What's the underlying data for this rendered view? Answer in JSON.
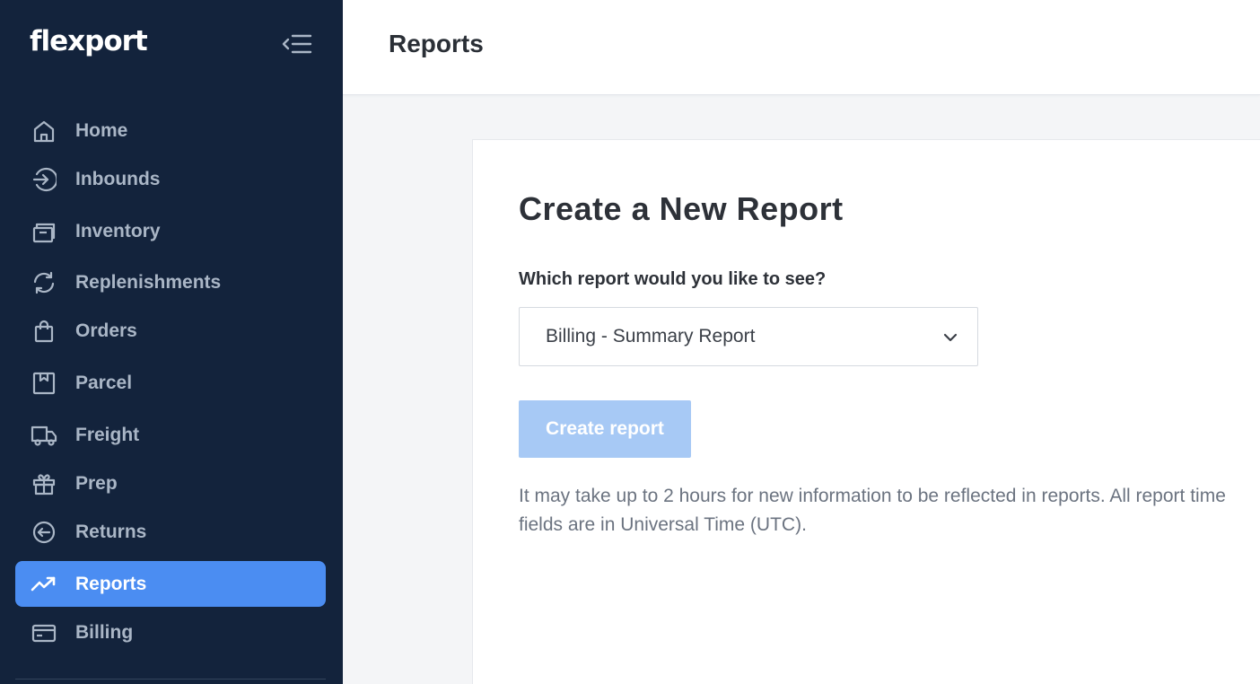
{
  "brand": {
    "name": "flexport"
  },
  "colors": {
    "sidebar_bg": "#13233c",
    "sidebar_text": "#aab6c6",
    "active_bg": "#4b8df2",
    "button_disabled_bg": "#a7c9f5",
    "page_bg": "#f4f5f7"
  },
  "sidebar": {
    "collapse_icon": "collapse-menu-icon",
    "items": [
      {
        "label": "Home",
        "icon": "home-icon",
        "active": false
      },
      {
        "label": "Inbounds",
        "icon": "inbound-arrow-icon",
        "active": false
      },
      {
        "label": "Inventory",
        "icon": "inventory-box-icon",
        "active": false
      },
      {
        "label": "Replenishments",
        "icon": "refresh-icon",
        "active": false
      },
      {
        "label": "Orders",
        "icon": "shopping-bag-icon",
        "active": false
      },
      {
        "label": "Parcel",
        "icon": "parcel-icon",
        "active": false
      },
      {
        "label": "Freight",
        "icon": "truck-icon",
        "active": false
      },
      {
        "label": "Prep",
        "icon": "gift-icon",
        "active": false
      },
      {
        "label": "Returns",
        "icon": "return-arrow-icon",
        "active": false
      },
      {
        "label": "Reports",
        "icon": "trend-up-icon",
        "active": true
      },
      {
        "label": "Billing",
        "icon": "credit-card-icon",
        "active": false
      }
    ]
  },
  "header": {
    "title": "Reports"
  },
  "main": {
    "card_title": "Create a New Report",
    "report_select": {
      "label": "Which report would you like to see?",
      "value": "Billing - Summary Report"
    },
    "create_button": {
      "label": "Create report",
      "disabled": true
    },
    "note": "It may take up to 2 hours for new information to be reflected in reports. All report time fields are in Universal Time (UTC)."
  }
}
